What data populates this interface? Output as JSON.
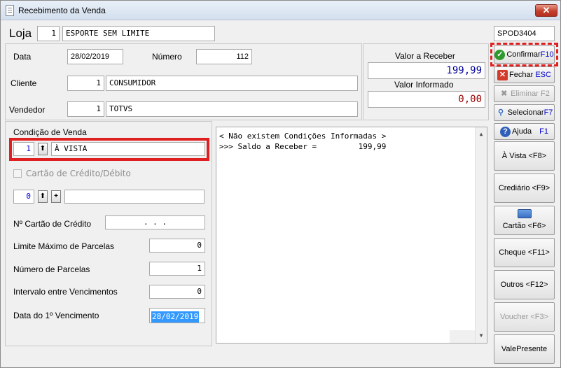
{
  "window": {
    "title": "Recebimento da Venda",
    "close_label": "✕"
  },
  "header": {
    "loja_label": "Loja",
    "loja_code": "1",
    "loja_name": "ESPORTE SEM LIMITE",
    "terminal": "SPOD3404"
  },
  "info": {
    "data_label": "Data",
    "data_value": "28/02/2019",
    "numero_label": "Número",
    "numero_value": "112",
    "cliente_label": "Cliente",
    "cliente_code": "1",
    "cliente_name": "CONSUMIDOR",
    "vendedor_label": "Vendedor",
    "vendedor_code": "1",
    "vendedor_name": "TOTVS"
  },
  "totals": {
    "receber_label": "Valor a Receber",
    "receber_value": "199,99",
    "informado_label": "Valor Informado",
    "informado_value": "0,00"
  },
  "condicao": {
    "label": "Condição de Venda",
    "code": "1",
    "name": "À VISTA",
    "cartao_checkbox_label": "Cartão de Crédito/Débito",
    "cartao_code": "0",
    "cartao_name": "",
    "numero_cartao_label": "Nº Cartão de Crédito",
    "numero_cartao_value": ".     .     .",
    "limite_label": "Limite Máximo de Parcelas",
    "limite_value": "0",
    "parcelas_label": "Número de Parcelas",
    "parcelas_value": "1",
    "intervalo_label": "Intervalo entre Vencimentos",
    "intervalo_value": "0",
    "vencimento_label": "Data do 1º Vencimento",
    "vencimento_value": "28/02/2019"
  },
  "messages": {
    "line1": "< Não existem Condições Informadas >",
    "line2": ">>> Saldo a Receber =         199,99"
  },
  "sidebar": {
    "confirmar": "Confirmar",
    "confirmar_key": "F10",
    "fechar": "Fechar",
    "fechar_key": "ESC",
    "eliminar": "Eliminar",
    "eliminar_key": "F2",
    "selecionar": "Selecionar",
    "selecionar_key": "F7",
    "ajuda": "Ajuda",
    "ajuda_key": "F1",
    "avista": "À Vista <F8>",
    "crediario": "Crediário <F9>",
    "cartao": "Cartão <F6>",
    "cheque": "Cheque <F11>",
    "outros": "Outros <F12>",
    "voucher": "Voucher <F3>",
    "valepresente": "ValePresente"
  },
  "colors": {
    "highlight_red": "#e02020",
    "value_blue": "#000099",
    "value_red": "#990000",
    "selection_blue": "#3399ff"
  }
}
